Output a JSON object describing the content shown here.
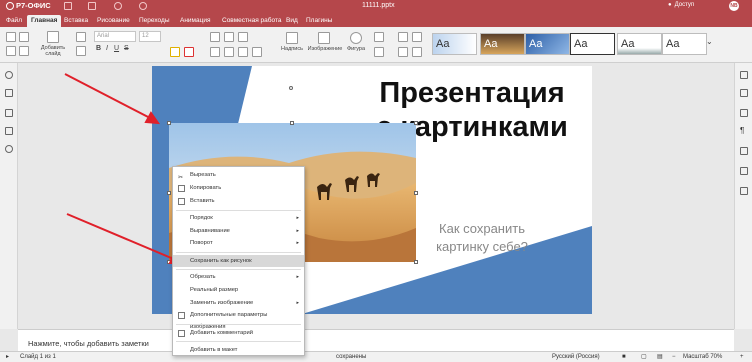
{
  "app": {
    "logo": "Р7-ОФИС",
    "filename": "11111.pptx",
    "access_label": "Доступ",
    "user_initials": "NB"
  },
  "tabs": [
    {
      "label": "Файл"
    },
    {
      "label": "Главная"
    },
    {
      "label": "Вставка"
    },
    {
      "label": "Рисование"
    },
    {
      "label": "Переходы"
    },
    {
      "label": "Анимация"
    },
    {
      "label": "Совместная работа"
    },
    {
      "label": "Вид"
    },
    {
      "label": "Плагины"
    }
  ],
  "ribbon": {
    "add_slide_line1": "Добавить",
    "add_slide_line2": "слайд",
    "font_combo": "Arial",
    "size_combo": "12",
    "caption_label": "Надпись",
    "image_label": "Изображение",
    "shape_label": "Фигура",
    "theme_sample": "Aa"
  },
  "slide": {
    "title_line1": "Презентация",
    "title_line2": "с картинками",
    "subtitle_line1": "Как сохранить",
    "subtitle_line2": "картинку себе?"
  },
  "context_menu": {
    "cut": "Вырезать",
    "copy": "Копировать",
    "paste": "Вставить",
    "order": "Порядок",
    "align": "Выравнивание",
    "rotate": "Поворот",
    "save_as_picture": "Сохранить как рисунок",
    "crop": "Обрезать",
    "actual_size": "Реальный размер",
    "replace_image": "Заменить изображение",
    "advanced": "Дополнительные параметры изображения",
    "add_comment": "Добавить комментарий",
    "add_to_layout": "Добавить в макет"
  },
  "notes": {
    "placeholder": "Нажмите, чтобы добавить заметки"
  },
  "status": {
    "slide_counter": "Слайд 1 из 1",
    "saved": "сохранены",
    "language": "Русский (Россия)",
    "zoom": "Масштаб 70%"
  },
  "colors": {
    "brand": "#b5474b",
    "slide_blue": "#4f81bd",
    "arrow": "#e0202a"
  }
}
